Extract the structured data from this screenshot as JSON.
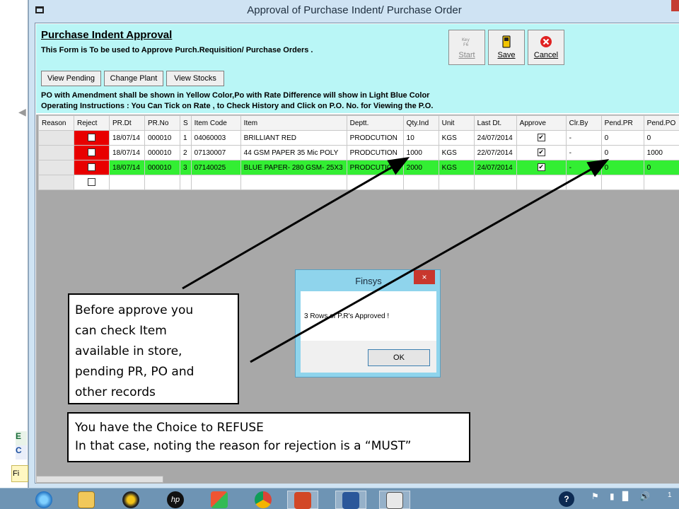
{
  "window": {
    "title": "Approval of Purchase Indent/ Purchase Order"
  },
  "form": {
    "heading": "Purchase Indent Approval",
    "subheading": "This Form is To be used to Approve Purch.Requisition/ Purchase Orders .",
    "buttons": {
      "view_pending": "View Pending",
      "change_plant": "Change Plant",
      "view_stocks": "View Stocks"
    },
    "toolbar": {
      "start": "Start",
      "save": "Save",
      "cancel": "Cancel"
    },
    "note1": "PO with Amendment shall be shown in Yellow Color,Po with Rate Difference will show in Light Blue Color",
    "note2": "Operating Instructions : You Can Tick on Rate , to Check History  and Click on P.O. No. for Viewing the P.O."
  },
  "grid": {
    "columns": [
      "Reason",
      "Reject",
      "PR.Dt",
      "PR.No",
      "S",
      "Item Code",
      "Item",
      "Deptt.",
      "Qty.Ind",
      "Unit",
      "Last Dt.",
      "Approve",
      "Clr.By",
      "Pend.PR",
      "Pend.PO"
    ],
    "rows": [
      {
        "pr_dt": "18/07/14",
        "pr_no": "000010",
        "s": "1",
        "item_code": "04060003",
        "item": "BRILLIANT RED",
        "deptt": "PRODCUTION",
        "qty": "10",
        "unit": "KGS",
        "last_dt": "24/07/2014",
        "clr_by": "-",
        "pend_pr": "0",
        "pend_po": "0"
      },
      {
        "pr_dt": "18/07/14",
        "pr_no": "000010",
        "s": "2",
        "item_code": "07130007",
        "item": "44 GSM PAPER  35 Mic POLY",
        "deptt": "PRODCUTION",
        "qty": "1000",
        "unit": "KGS",
        "last_dt": "22/07/2014",
        "clr_by": "-",
        "pend_pr": "0",
        "pend_po": "1000"
      },
      {
        "pr_dt": "18/07/14",
        "pr_no": "000010",
        "s": "3",
        "item_code": "07140025",
        "item": "BLUE PAPER- 280 GSM- 25X3",
        "deptt": "PRODCUTION",
        "qty": "2000",
        "unit": "KGS",
        "last_dt": "24/07/2014",
        "clr_by": "-",
        "pend_pr": "0",
        "pend_po": "0"
      }
    ],
    "highlight_color": "#33ee33",
    "reject_color": "#e80000"
  },
  "dialog": {
    "title": "Finsys",
    "message": "3 Rows of P.R's Approved !",
    "ok": "OK",
    "close": "×"
  },
  "callouts": {
    "approve_tip": [
      "Before approve you",
      "can check Item",
      "available in  store,",
      "pending PR, PO and",
      "other records"
    ],
    "refuse_tip": [
      "You have the Choice to REFUSE",
      "In that case, noting the reason for rejection is a “MUST”"
    ]
  },
  "background": {
    "left_e": "E",
    "left_c": "C",
    "left_fi": "Fi"
  },
  "taskbar": {
    "icons": [
      "ie-icon",
      "file-explorer-icon",
      "media-player-icon",
      "hp-icon",
      "puzzle-app-icon",
      "chrome-icon",
      "powerpoint-icon",
      "word-icon",
      "finsys-window-icon"
    ],
    "clock_partial": "1"
  }
}
